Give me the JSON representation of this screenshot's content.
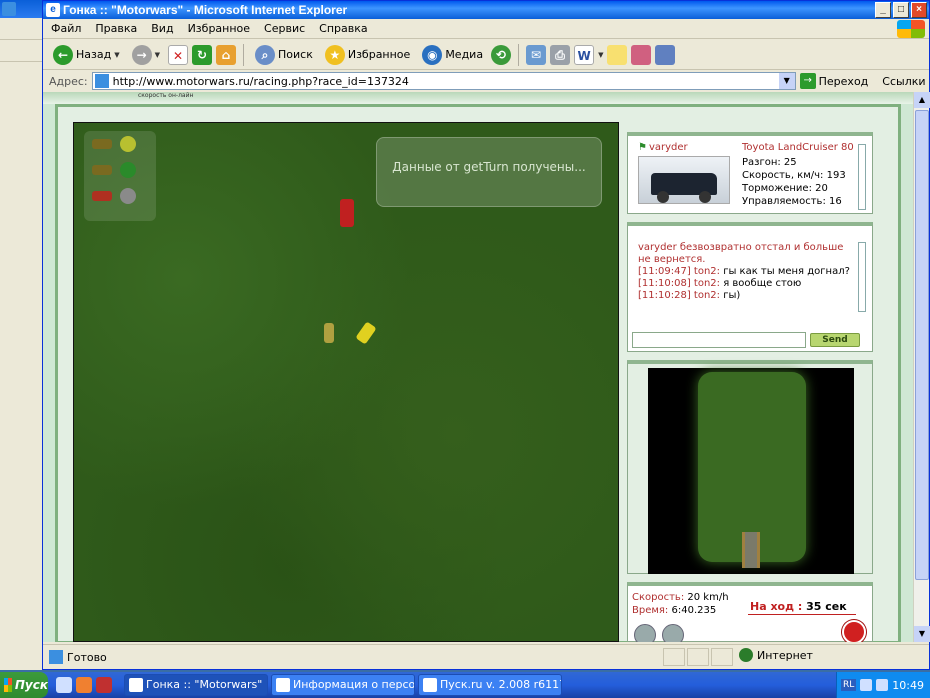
{
  "window": {
    "title": "Гонка :: \"Motorwars\" - Microsoft Internet Explorer",
    "min": "_",
    "max": "□",
    "close": "×"
  },
  "menu": [
    "Файл",
    "Правка",
    "Вид",
    "Избранное",
    "Сервис",
    "Справка"
  ],
  "toolbar": {
    "back": "Назад",
    "search": "Поиск",
    "favorites": "Избранное",
    "media": "Медиа"
  },
  "address": {
    "label": "Адрес:",
    "url": "http://www.motorwars.ru/racing.php?race_id=137324",
    "go": "Переход",
    "links": "Ссылки"
  },
  "page_header": "скорость он-лайн",
  "game": {
    "message": "Данные от getTurn получены..."
  },
  "car_panel": {
    "user": "varyder",
    "model": "Toyota LandCruiser 80",
    "stats": [
      "Разгон: 25",
      "Скорость, км/ч: 193",
      "Торможение: 20",
      "Управляемость: 16"
    ]
  },
  "chat": {
    "system": "varyder безвозвратно отстал и больше не вернется.",
    "messages": [
      {
        "time": "[11:09:47]",
        "user": "ton2:",
        "text": "гы как ты меня догнал?"
      },
      {
        "time": "[11:10:08]",
        "user": "ton2:",
        "text": "я вообще стою"
      },
      {
        "time": "[11:10:28]",
        "user": "ton2:",
        "text": "гы)"
      }
    ],
    "send": "Send"
  },
  "status": {
    "speed_label": "Скорость:",
    "speed_value": "20 km/h",
    "time_label": "Время:",
    "time_value": "6:40.235",
    "turn_label": "На ход :",
    "turn_value": "35 сек"
  },
  "statusbar": {
    "text": "Готово",
    "zone": "Интернет"
  },
  "taskbar": {
    "start": "Пуск",
    "tasks": [
      "Гонка :: \"Motorwars\" ...",
      "Информация о персона...",
      "Пуск.ru v. 2.008 r6117 -..."
    ],
    "lang": "RL",
    "clock": "10:49"
  },
  "colors": {
    "grass": "#2f5a1a",
    "accent_red": "#b03030",
    "send_green": "#b8d670"
  }
}
